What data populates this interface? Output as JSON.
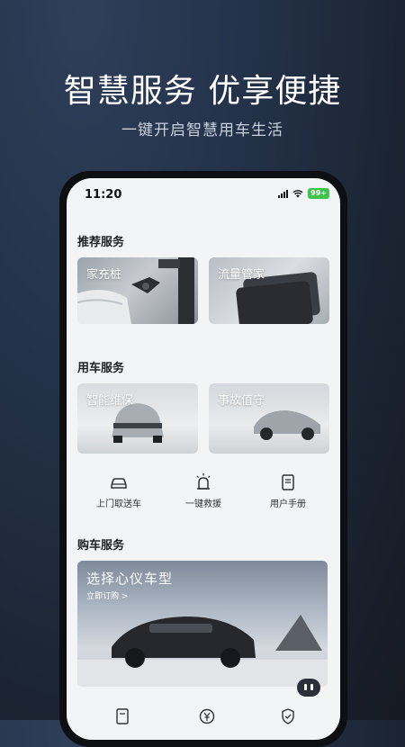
{
  "hero": {
    "title": "智慧服务 优享便捷",
    "subtitle": "一键开启智慧用车生活"
  },
  "status_bar": {
    "time": "11:20",
    "battery": "99+"
  },
  "recommended": {
    "title": "推荐服务",
    "cards": [
      {
        "label": "家充桩"
      },
      {
        "label": "流量管家"
      }
    ]
  },
  "car_services": {
    "title": "用车服务",
    "cards": [
      {
        "label": "智能维保"
      },
      {
        "label": "事故值守"
      }
    ],
    "actions": [
      {
        "label": "上门取送车",
        "icon": "car-pickup-icon"
      },
      {
        "label": "一键救援",
        "icon": "rescue-beacon-icon"
      },
      {
        "label": "用户手册",
        "icon": "manual-icon"
      }
    ]
  },
  "purchase": {
    "title": "购车服务",
    "banner_title": "选择心仪车型",
    "banner_link": "立即订购 >"
  },
  "bottom_icons": [
    "calculator-icon",
    "yuan-icon",
    "shield-icon"
  ],
  "colors": {
    "battery": "#3ec44a",
    "background": "#1c2433"
  }
}
